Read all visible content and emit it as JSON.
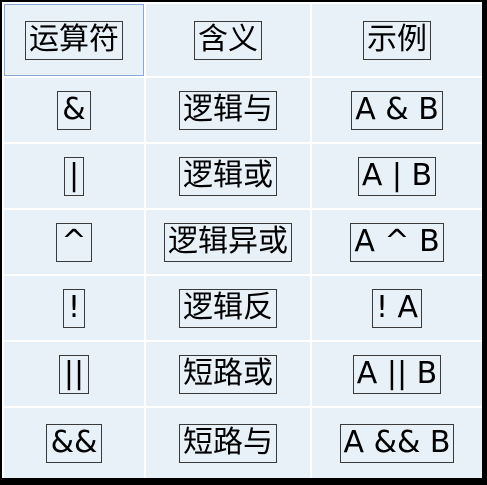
{
  "table": {
    "headers": [
      "运算符",
      "含义",
      "示例"
    ],
    "rows": [
      {
        "operator": "&",
        "meaning": "逻辑与",
        "example": "A & B"
      },
      {
        "operator": "|",
        "meaning": "逻辑或",
        "example": "A | B"
      },
      {
        "operator": "^",
        "meaning": "逻辑异或",
        "example": "A ^ B"
      },
      {
        "operator": "!",
        "meaning": "逻辑反",
        "example": "! A"
      },
      {
        "operator": "||",
        "meaning": "短路或",
        "example": "A || B"
      },
      {
        "operator": "&&",
        "meaning": "短路与",
        "example": "A && B"
      }
    ]
  }
}
